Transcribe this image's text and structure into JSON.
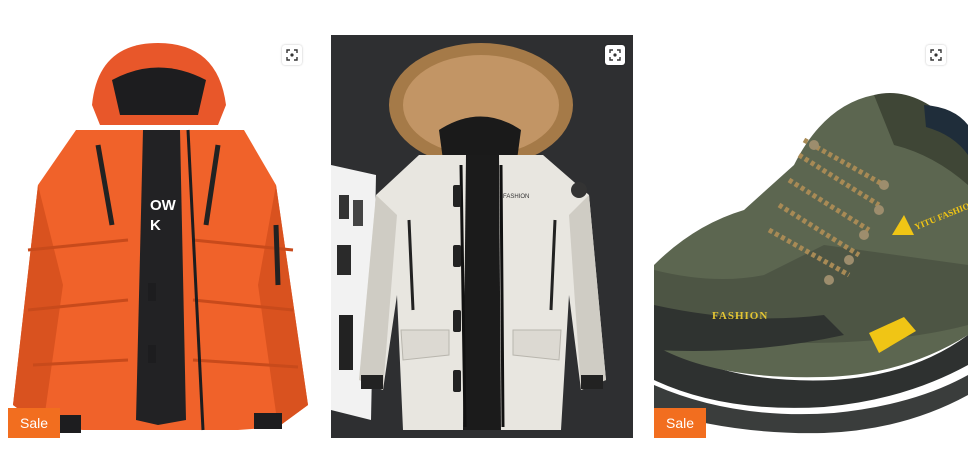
{
  "products": [
    {
      "badge": "Sale",
      "image_alt": "Orange hooded down jacket",
      "zoom_icon": "expand-icon",
      "colors": {
        "main": "#f0622a"
      }
    },
    {
      "badge": "",
      "image_alt": "White parka with fur hood",
      "zoom_icon": "expand-icon",
      "colors": {
        "main": "#e8e6e0"
      }
    },
    {
      "badge": "Sale",
      "image_alt": "Army green hiking shoe",
      "zoom_icon": "expand-icon",
      "shoe_text": {
        "brand": "FASHION",
        "logo": "YITU FASHION"
      },
      "colors": {
        "main": "#5c6650"
      }
    }
  ],
  "colors": {
    "sale_badge": "#f26e1f"
  }
}
